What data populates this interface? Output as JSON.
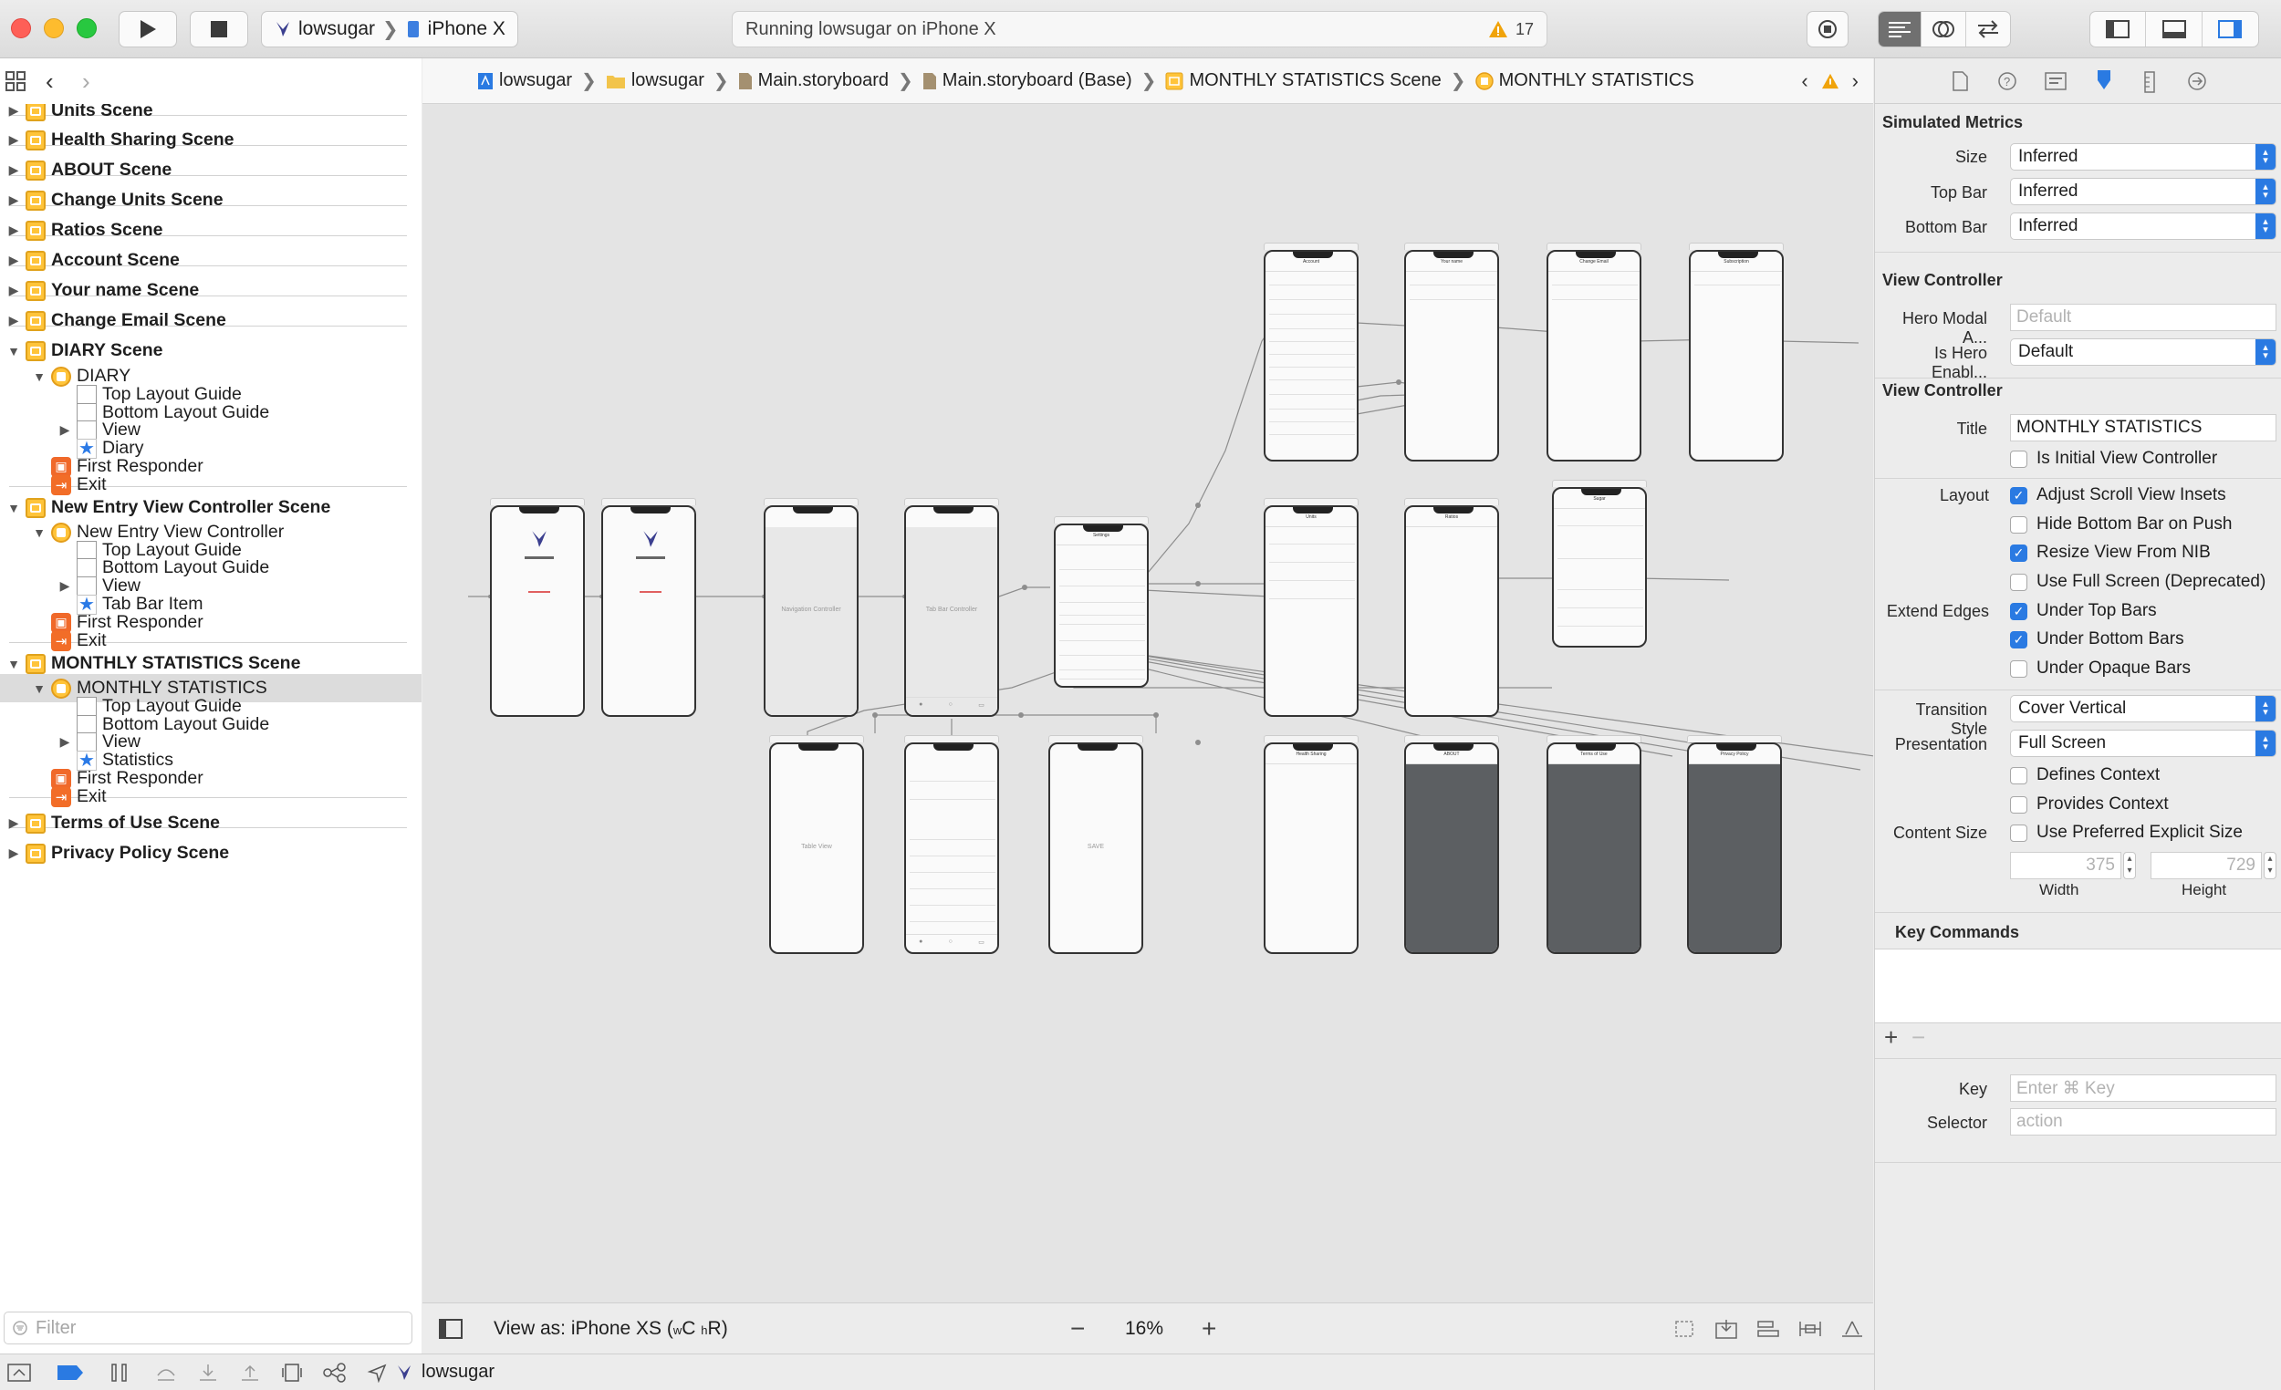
{
  "toolbar": {
    "scheme": "lowsugar",
    "device": "iPhone X",
    "status": "Running lowsugar on iPhone X",
    "warning_count": "17"
  },
  "navigator": {
    "filter_placeholder": "Filter",
    "rows": [
      {
        "label": "Units Scene",
        "indent": 0,
        "icon": "scene",
        "bold": true,
        "tri": "right"
      },
      {
        "label": "Health Sharing Scene",
        "indent": 0,
        "icon": "scene",
        "bold": true,
        "tri": "right"
      },
      {
        "label": "ABOUT Scene",
        "indent": 0,
        "icon": "scene",
        "bold": true,
        "tri": "right"
      },
      {
        "label": "Change Units Scene",
        "indent": 0,
        "icon": "scene",
        "bold": true,
        "tri": "right"
      },
      {
        "label": "Ratios Scene",
        "indent": 0,
        "icon": "scene",
        "bold": true,
        "tri": "right"
      },
      {
        "label": "Account Scene",
        "indent": 0,
        "icon": "scene",
        "bold": true,
        "tri": "right"
      },
      {
        "label": "Your name Scene",
        "indent": 0,
        "icon": "scene",
        "bold": true,
        "tri": "right"
      },
      {
        "label": "Change Email Scene",
        "indent": 0,
        "icon": "scene",
        "bold": true,
        "tri": "right"
      },
      {
        "label": "DIARY Scene",
        "indent": 0,
        "icon": "scene",
        "bold": true,
        "tri": "down"
      },
      {
        "label": "DIARY",
        "indent": 1,
        "icon": "vc",
        "bold": false,
        "tri": "down"
      },
      {
        "label": "Top Layout Guide",
        "indent": 2,
        "icon": "guide",
        "bold": false,
        "tri": ""
      },
      {
        "label": "Bottom Layout Guide",
        "indent": 2,
        "icon": "guide",
        "bold": false,
        "tri": ""
      },
      {
        "label": "View",
        "indent": 2,
        "icon": "guide",
        "bold": false,
        "tri": "right"
      },
      {
        "label": "Diary",
        "indent": 2,
        "icon": "star",
        "bold": false,
        "tri": ""
      },
      {
        "label": "First Responder",
        "indent": 1,
        "icon": "fr",
        "bold": false,
        "tri": ""
      },
      {
        "label": "Exit",
        "indent": 1,
        "icon": "exit",
        "bold": false,
        "tri": ""
      },
      {
        "label": "New Entry View Controller Scene",
        "indent": 0,
        "icon": "scene",
        "bold": true,
        "tri": "down"
      },
      {
        "label": "New Entry View Controller",
        "indent": 1,
        "icon": "vc",
        "bold": false,
        "tri": "down"
      },
      {
        "label": "Top Layout Guide",
        "indent": 2,
        "icon": "guide",
        "bold": false,
        "tri": ""
      },
      {
        "label": "Bottom Layout Guide",
        "indent": 2,
        "icon": "guide",
        "bold": false,
        "tri": ""
      },
      {
        "label": "View",
        "indent": 2,
        "icon": "guide",
        "bold": false,
        "tri": "right"
      },
      {
        "label": "Tab Bar Item",
        "indent": 2,
        "icon": "star",
        "bold": false,
        "tri": ""
      },
      {
        "label": "First Responder",
        "indent": 1,
        "icon": "fr",
        "bold": false,
        "tri": ""
      },
      {
        "label": "Exit",
        "indent": 1,
        "icon": "exit",
        "bold": false,
        "tri": ""
      },
      {
        "label": "MONTHLY STATISTICS Scene",
        "indent": 0,
        "icon": "scene",
        "bold": true,
        "tri": "down"
      },
      {
        "label": "MONTHLY STATISTICS",
        "indent": 1,
        "icon": "vc",
        "bold": false,
        "tri": "down",
        "selected": true
      },
      {
        "label": "Top Layout Guide",
        "indent": 2,
        "icon": "guide",
        "bold": false,
        "tri": ""
      },
      {
        "label": "Bottom Layout Guide",
        "indent": 2,
        "icon": "guide",
        "bold": false,
        "tri": ""
      },
      {
        "label": "View",
        "indent": 2,
        "icon": "guide",
        "bold": false,
        "tri": "right"
      },
      {
        "label": "Statistics",
        "indent": 2,
        "icon": "star",
        "bold": false,
        "tri": ""
      },
      {
        "label": "First Responder",
        "indent": 1,
        "icon": "fr",
        "bold": false,
        "tri": ""
      },
      {
        "label": "Exit",
        "indent": 1,
        "icon": "exit",
        "bold": false,
        "tri": ""
      },
      {
        "label": "Terms of Use Scene",
        "indent": 0,
        "icon": "scene",
        "bold": true,
        "tri": "right"
      },
      {
        "label": "Privacy Policy Scene",
        "indent": 0,
        "icon": "scene",
        "bold": true,
        "tri": "right"
      }
    ]
  },
  "breadcrumbs": [
    {
      "label": "lowsugar",
      "icon": "project"
    },
    {
      "label": "lowsugar",
      "icon": "folder"
    },
    {
      "label": "Main.storyboard",
      "icon": "storyboard"
    },
    {
      "label": "Main.storyboard (Base)",
      "icon": "storyboard"
    },
    {
      "label": "MONTHLY STATISTICS Scene",
      "icon": "scene"
    },
    {
      "label": "MONTHLY STATISTICS",
      "icon": "vc"
    }
  ],
  "canvas": {
    "view_as": "View as: iPhone XS (",
    "size_w": "w",
    "size_c": "C",
    "size_h": "h",
    "size_r": "R",
    "view_as_close": ")",
    "zoom": "16%",
    "scene_labels": {
      "navigation_controller": "Navigation Controller",
      "tab_bar_controller": "Tab Bar Controller",
      "settings": "Settings",
      "account": "Account",
      "your_name": "Your name",
      "change_email": "Change Email",
      "subscription": "Subscription",
      "units": "Units",
      "ratios": "Ratios",
      "health_sharing": "Health Sharing",
      "about": "ABOUT",
      "terms": "Terms of Use",
      "privacy": "Privacy Policy",
      "table_view": "Table View",
      "save": "SAVE",
      "sugar": "Sugar"
    }
  },
  "inspector": {
    "simulated_metrics": "Simulated Metrics",
    "size_label": "Size",
    "size_value": "Inferred",
    "top_bar_label": "Top Bar",
    "top_bar_value": "Inferred",
    "bottom_bar_label": "Bottom Bar",
    "bottom_bar_value": "Inferred",
    "view_controller_1": "View Controller",
    "hero_modal_label": "Hero Modal A...",
    "hero_modal_placeholder": "Default",
    "hero_enabled_label": "Is Hero Enabl...",
    "hero_enabled_value": "Default",
    "view_controller_2": "View Controller",
    "title_label": "Title",
    "title_value": "MONTHLY STATISTICS",
    "initial_vc": "Is Initial View Controller",
    "layout_label": "Layout",
    "adjust_insets": "Adjust Scroll View Insets",
    "hide_bottom_bar": "Hide Bottom Bar on Push",
    "resize_nib": "Resize View From NIB",
    "full_screen": "Use Full Screen (Deprecated)",
    "extend_edges_label": "Extend Edges",
    "under_top": "Under Top Bars",
    "under_bottom": "Under Bottom Bars",
    "under_opaque": "Under Opaque Bars",
    "transition_label": "Transition Style",
    "transition_value": "Cover Vertical",
    "presentation_label": "Presentation",
    "presentation_value": "Full Screen",
    "defines_context": "Defines Context",
    "provides_context": "Provides Context",
    "content_size_label": "Content Size",
    "preferred_size": "Use Preferred Explicit Size",
    "width_value": "375",
    "height_value": "729",
    "width_label": "Width",
    "height_label": "Height",
    "key_commands": "Key Commands",
    "key_label": "Key",
    "key_placeholder": "Enter ⌘ Key",
    "selector_label": "Selector",
    "selector_placeholder": "action"
  },
  "debug": {
    "target": "lowsugar"
  },
  "colors": {
    "accent": "#2a7ae2",
    "scene_icon": "#ffc43a",
    "dark_view": "#5c5f62",
    "warning": "#f0a30a"
  }
}
